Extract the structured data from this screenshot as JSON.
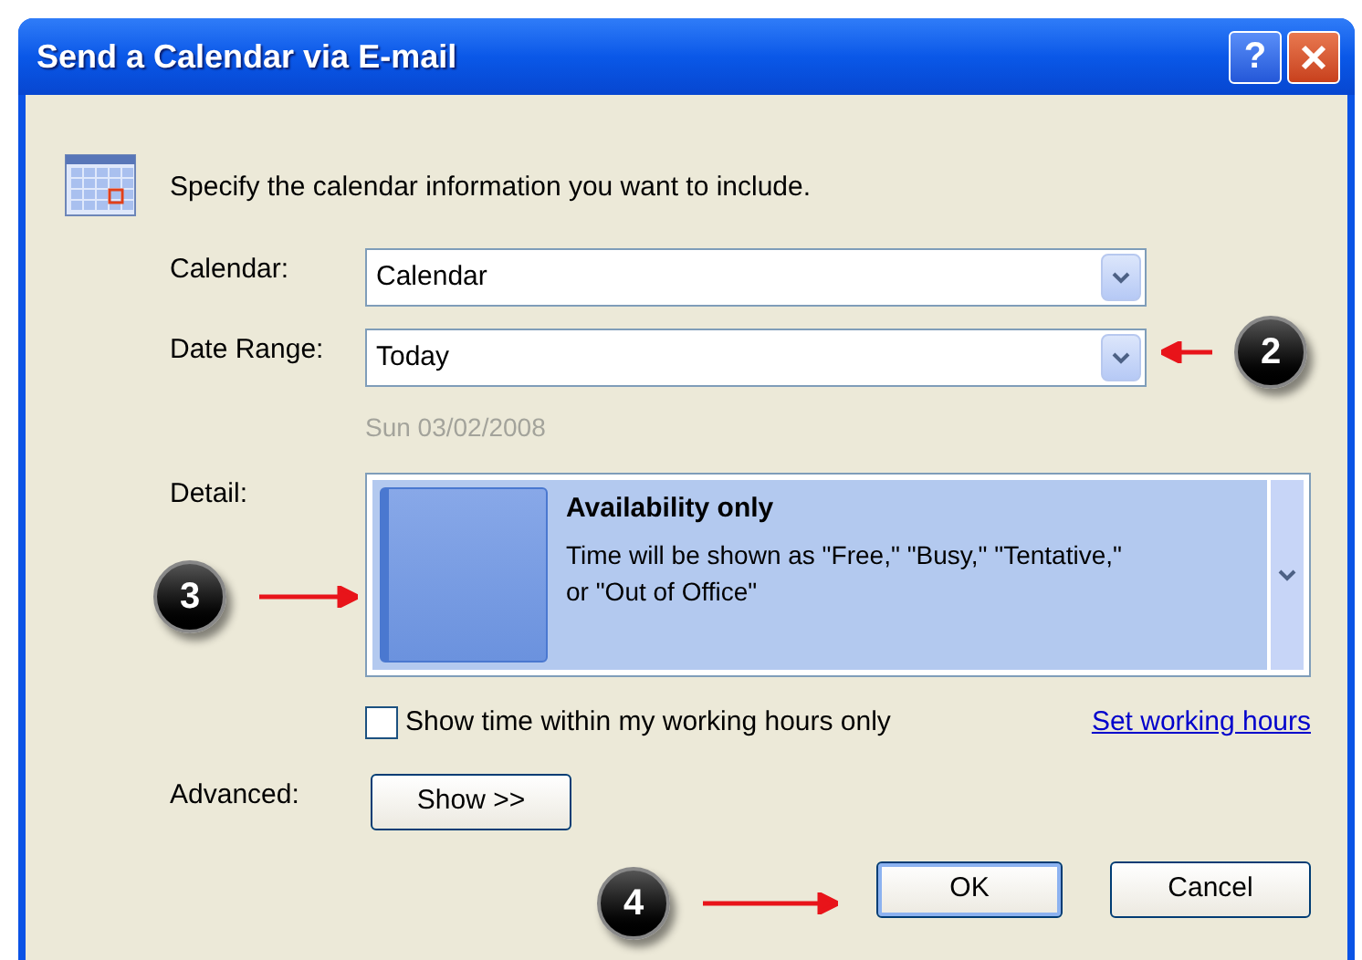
{
  "window": {
    "title": "Send a Calendar via E-mail",
    "help_label": "?"
  },
  "intro": "Specify the calendar information you want to include.",
  "fields": [
    {
      "label": "Calendar:",
      "value": "Calendar"
    },
    {
      "label": "Date Range:",
      "value": "Today"
    }
  ],
  "date_hint": "Sun 03/02/2008",
  "detail": {
    "label": "Detail:",
    "title": "Availability only",
    "description": "Time will be shown as \"Free,\" \"Busy,\" \"Tentative,\" or \"Out of Office\""
  },
  "working_hours": {
    "label": "Show time within my working hours only",
    "checked": false
  },
  "link": "Set working hours",
  "advanced": {
    "label": "Advanced:",
    "button": "Show >>"
  },
  "buttons": [
    {
      "label": "OK",
      "selected": true
    },
    {
      "label": "Cancel",
      "selected": false
    }
  ],
  "callouts": [
    {
      "number": "2"
    },
    {
      "number": "3"
    },
    {
      "number": "4"
    }
  ]
}
